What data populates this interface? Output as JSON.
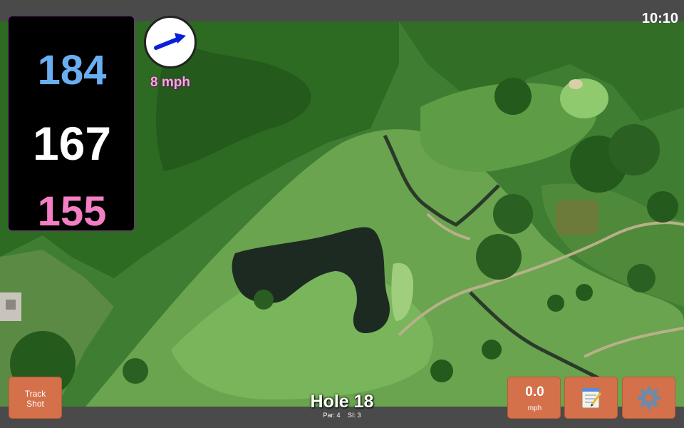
{
  "status_bar": {
    "time": "10:10"
  },
  "distances": {
    "back": "184",
    "middle": "167",
    "front": "155"
  },
  "wind": {
    "speed": "8 mph",
    "direction_icon": "arrow-icon"
  },
  "buttons": {
    "track_shot_line1": "Track",
    "track_shot_line2": "Shot",
    "speed_value": "0.0",
    "speed_unit": "mph",
    "notes_icon": "notepad-icon",
    "settings_icon": "gear-icon"
  },
  "hole": {
    "title": "Hole 18",
    "par": "Par: 4",
    "stroke_index": "SI: 3"
  },
  "colors": {
    "back_distance": "#6aaef2",
    "middle_distance": "#ffffff",
    "front_distance": "#f47ec4",
    "button": "#d4714a",
    "wind_text": "#f6a8e4"
  }
}
